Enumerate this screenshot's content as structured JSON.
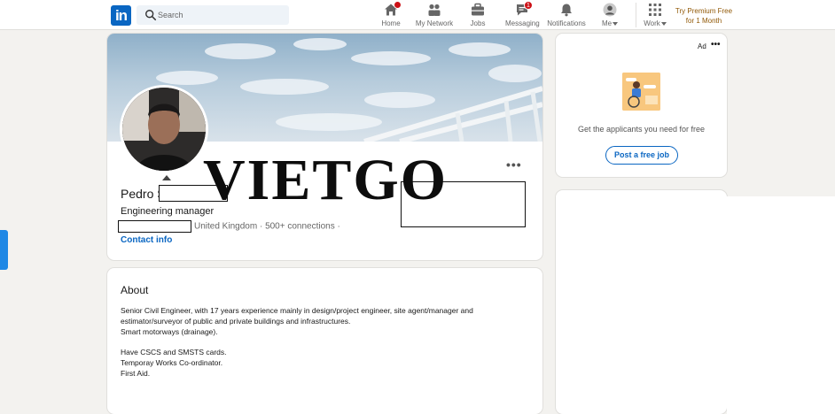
{
  "nav": {
    "logo_text": "in",
    "search_placeholder": "Search",
    "items": [
      {
        "label": "Home",
        "icon": "home-icon"
      },
      {
        "label": "My Network",
        "icon": "network-icon"
      },
      {
        "label": "Jobs",
        "icon": "briefcase-icon"
      },
      {
        "label": "Messaging",
        "icon": "messaging-icon",
        "badge": "1"
      },
      {
        "label": "Notifications",
        "icon": "bell-icon"
      },
      {
        "label": "Me",
        "icon": "avatar-icon"
      },
      {
        "label": "Work",
        "icon": "grid-icon"
      }
    ],
    "premium_line1": "Try Premium Free",
    "premium_line2": "for 1 Month"
  },
  "profile": {
    "name": "Pedro S",
    "headline": "Engineering manager",
    "location": "United Kingdom",
    "separator": "·",
    "connections": "500+ connections",
    "contact_label": "Contact info",
    "more_label": "•••"
  },
  "watermark": "VIETGO",
  "about": {
    "title": "About",
    "lines": [
      "Senior Civil Engineer, with 17 years experience mainly in design/project engineer, site agent/manager and",
      "estimator/surveyor of public and private buildings and infrastructures.",
      "Smart motorways (drainage).",
      "",
      "Have CSCS and SMSTS cards.",
      "Temporay Works Co-ordinator.",
      "First Aid."
    ]
  },
  "ad": {
    "label": "Ad",
    "more_label": "•••",
    "text": "Get the applicants you need for free",
    "button": "Post a free job"
  },
  "colors": {
    "brand": "#0a66c2",
    "page_bg": "#f3f2ef",
    "badge": "#cc1016",
    "premium": "#915907"
  }
}
